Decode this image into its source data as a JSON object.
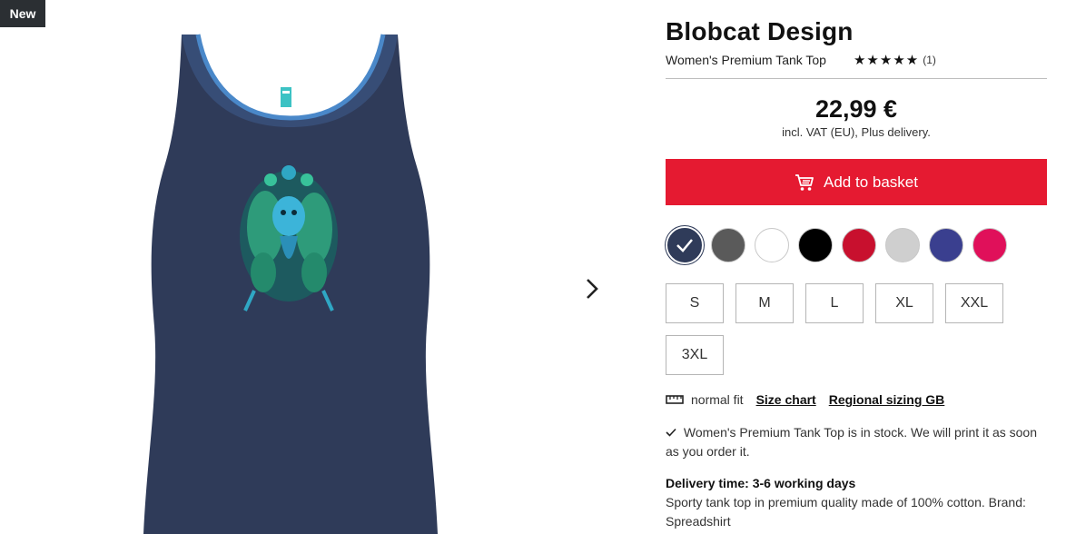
{
  "badge": {
    "label": "New"
  },
  "product": {
    "title": "Blobcat Design",
    "subtitle": "Women's Premium Tank Top",
    "rating_count": "(1)",
    "price": "22,99 €",
    "vat_note": "incl. VAT (EU), Plus delivery.",
    "add_to_basket": "Add to basket",
    "icons": {
      "cart": "cart-icon",
      "next": "chevron-right-icon",
      "ruler": "ruler-icon",
      "check": "checkmark-icon"
    }
  },
  "colors": [
    {
      "name": "navy",
      "hex": "#2f3b59",
      "selected": true
    },
    {
      "name": "grey",
      "hex": "#5a5a5a",
      "selected": false
    },
    {
      "name": "white",
      "hex": "#ffffff",
      "selected": false
    },
    {
      "name": "black",
      "hex": "#000000",
      "selected": false
    },
    {
      "name": "red",
      "hex": "#c8102e",
      "selected": false
    },
    {
      "name": "light-grey",
      "hex": "#cfcfcf",
      "selected": false
    },
    {
      "name": "royal-blue",
      "hex": "#3a3f8f",
      "selected": false
    },
    {
      "name": "pink",
      "hex": "#e0105a",
      "selected": false
    }
  ],
  "sizes": [
    "S",
    "M",
    "L",
    "XL",
    "XXL",
    "3XL"
  ],
  "fit": {
    "label": "normal fit",
    "size_chart": "Size chart",
    "regional_sizing": "Regional sizing GB"
  },
  "stock": {
    "text": "Women's Premium Tank Top is in stock. We will print it as soon as you order it."
  },
  "delivery": {
    "heading": "Delivery time: 3-6 working days",
    "description": "Sporty tank top in premium quality made of 100% cotton. Brand: Spreadshirt"
  }
}
